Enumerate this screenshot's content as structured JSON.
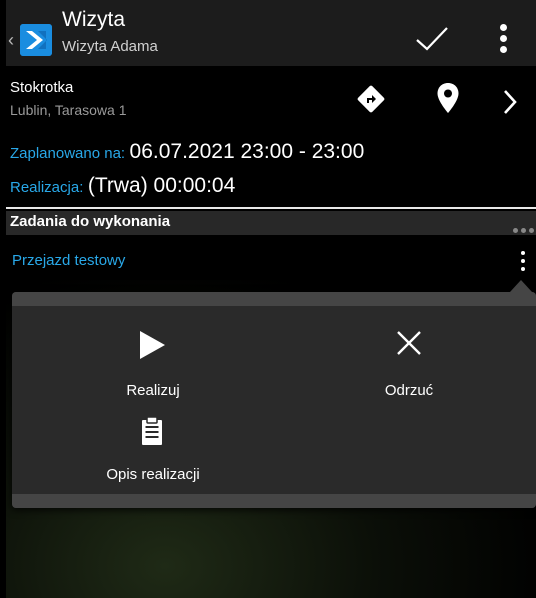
{
  "header": {
    "title": "Wizyta",
    "subtitle": "Wizyta Adama",
    "icons": [
      "back-chevron-icon",
      "app-logo-icon",
      "check-icon",
      "more-vert-icon"
    ]
  },
  "store": {
    "name": "Stokrotka",
    "address": "Lublin, Tarasowa 1",
    "icons": [
      "directions-icon",
      "map-pin-icon",
      "chevron-right-icon"
    ]
  },
  "visit": {
    "planned_label": "Zaplanowano na:",
    "planned_value": "06.07.2021 23:00 - 23:00",
    "realization_label": "Realizacja:",
    "realization_value": "(Trwa) 00:00:04"
  },
  "tasks": {
    "title": "Zadania do wykonania",
    "items": [
      {
        "name": "Przejazd testowy"
      }
    ]
  },
  "popup": {
    "actions": [
      {
        "label": "Realizuj",
        "icon": "play-icon"
      },
      {
        "label": "Odrzuć",
        "icon": "close-icon"
      },
      {
        "label": "Opis realizacji",
        "icon": "clipboard-icon"
      }
    ]
  },
  "colors": {
    "accent": "#29a8e8",
    "app_logo": "#1a8de0",
    "header_bg": "#1c1c1c",
    "popup_bg": "#2a2a2a"
  }
}
